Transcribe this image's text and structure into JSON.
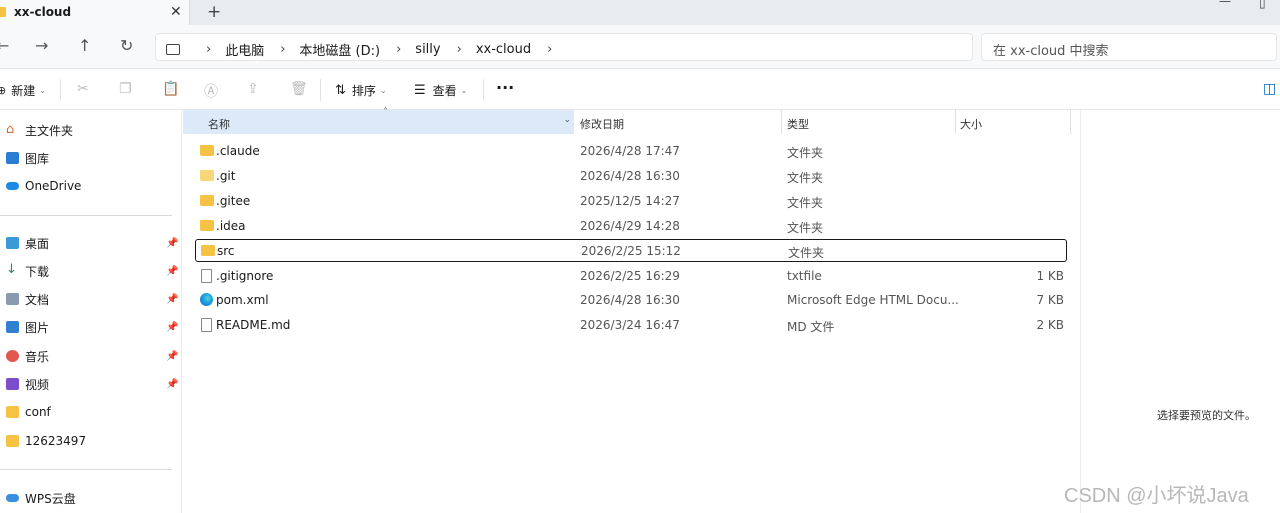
{
  "window": {
    "tab_title": "xx-cloud",
    "tab_close": "✕",
    "new_tab": "+",
    "minimize": "—",
    "maximize": "▯"
  },
  "nav": {
    "back": "←",
    "forward": "→",
    "up": "↑",
    "refresh": "↻",
    "breadcrumbs": [
      "此电脑",
      "本地磁盘 (D:)",
      "silly",
      "xx-cloud"
    ],
    "search_placeholder": "在 xx-cloud 中搜索"
  },
  "commands": {
    "new_label": "新建",
    "sort_label": "排序",
    "view_label": "查看",
    "more_label": "···"
  },
  "sidebar": {
    "quick": [
      {
        "label": "主文件夹",
        "icon": "home-icon"
      },
      {
        "label": "图库",
        "icon": "gallery-icon"
      },
      {
        "label": "OneDrive",
        "icon": "cloud-icon"
      }
    ],
    "pinned": [
      {
        "label": "桌面",
        "icon": "desktop-icon",
        "pin": "📌"
      },
      {
        "label": "下载",
        "icon": "download-icon",
        "pin": "📌"
      },
      {
        "label": "文档",
        "icon": "documents-icon",
        "pin": "📌"
      },
      {
        "label": "图片",
        "icon": "pictures-icon",
        "pin": "📌"
      },
      {
        "label": "音乐",
        "icon": "music-icon",
        "pin": "📌"
      },
      {
        "label": "视频",
        "icon": "videos-icon",
        "pin": "📌"
      },
      {
        "label": "conf",
        "icon": "folder-icon"
      },
      {
        "label": "12623497",
        "icon": "folder-icon"
      }
    ],
    "bottom": [
      {
        "label": "WPS云盘",
        "icon": "cloud-icon"
      }
    ]
  },
  "columns": {
    "name": "名称",
    "date": "修改日期",
    "type": "类型",
    "size": "大小"
  },
  "files": [
    {
      "name": ".claude",
      "date": "2026/4/28 17:47",
      "type": "文件夹",
      "size": "",
      "kind": "folder"
    },
    {
      "name": ".git",
      "date": "2026/4/28 16:30",
      "type": "文件夹",
      "size": "",
      "kind": "folder"
    },
    {
      "name": ".gitee",
      "date": "2025/12/5 14:27",
      "type": "文件夹",
      "size": "",
      "kind": "folder"
    },
    {
      "name": ".idea",
      "date": "2026/4/29 14:28",
      "type": "文件夹",
      "size": "",
      "kind": "folder"
    },
    {
      "name": "src",
      "date": "2026/2/25 15:12",
      "type": "文件夹",
      "size": "",
      "kind": "folder"
    },
    {
      "name": ".gitignore",
      "date": "2026/2/25 16:29",
      "type": "txtfile",
      "size": "1 KB",
      "kind": "doc"
    },
    {
      "name": "pom.xml",
      "date": "2026/4/28 16:30",
      "type": "Microsoft Edge HTML Docu...",
      "size": "7 KB",
      "kind": "edge"
    },
    {
      "name": "README.md",
      "date": "2026/3/24 16:47",
      "type": "MD 文件",
      "size": "2 KB",
      "kind": "doc"
    }
  ],
  "preview": {
    "message": "选择要预览的文件。"
  },
  "watermark": "CSDN @小坏说Java",
  "colors": {
    "folder": "#f6c244",
    "header_selected": "#dbe9f8",
    "accent": "#0067c0"
  }
}
